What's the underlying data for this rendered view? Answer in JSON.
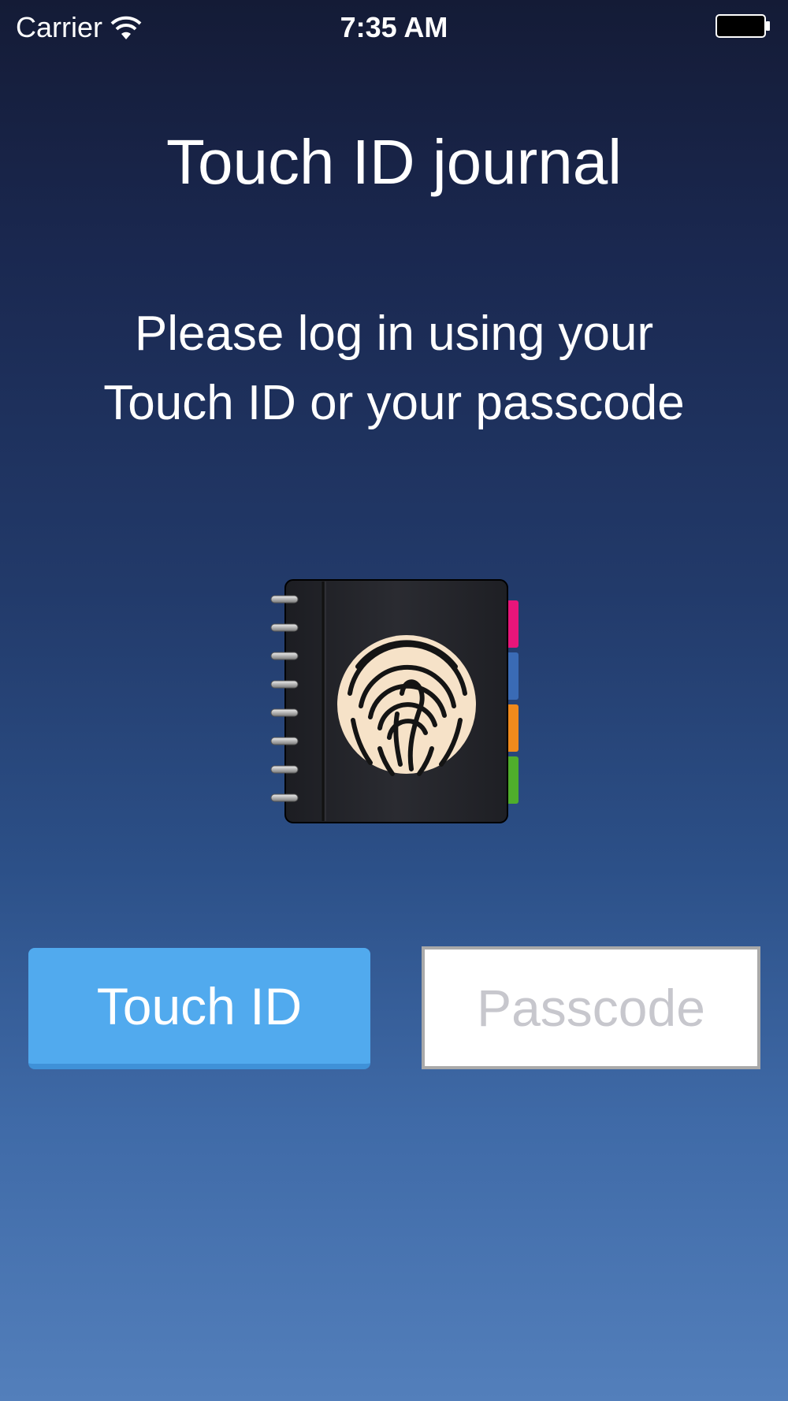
{
  "status_bar": {
    "carrier": "Carrier",
    "time": "7:35 AM",
    "icons": [
      "wifi-icon",
      "battery-icon"
    ]
  },
  "title": "Touch ID journal",
  "instructions": {
    "line1": "Please log in using your",
    "line2": "Touch ID or your passcode"
  },
  "journal_icon": {
    "name": "fingerprint-journal-icon",
    "tab_colors": [
      "#e8157a",
      "#3a6bb5",
      "#f08a1c",
      "#4fae2c"
    ]
  },
  "touch_id_button": {
    "label": "Touch ID",
    "color": "#51aaee"
  },
  "passcode": {
    "placeholder": "Passcode",
    "value": ""
  }
}
